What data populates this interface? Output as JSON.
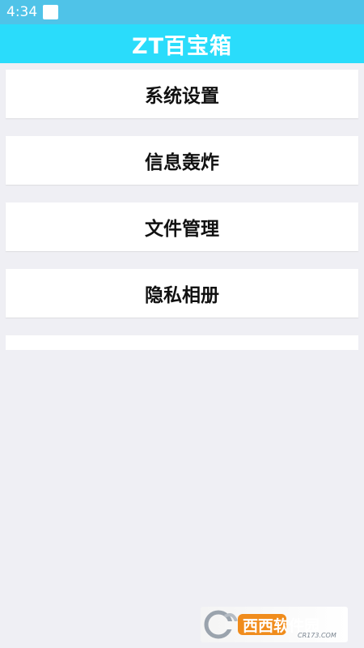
{
  "status_bar": {
    "time": "4:34"
  },
  "app_bar": {
    "title": "ZT百宝箱"
  },
  "menu": {
    "items": [
      {
        "label": "系统设置"
      },
      {
        "label": "信息轰炸"
      },
      {
        "label": "文件管理"
      },
      {
        "label": "隐私相册"
      }
    ]
  },
  "watermark": {
    "logo_text": "西西软件园",
    "logo_sub": "CR173.COM"
  },
  "colors": {
    "status_bar": "#4fc3e8",
    "app_bar": "#2adcfb",
    "background": "#efeff4",
    "card": "#ffffff",
    "text": "#111111"
  }
}
